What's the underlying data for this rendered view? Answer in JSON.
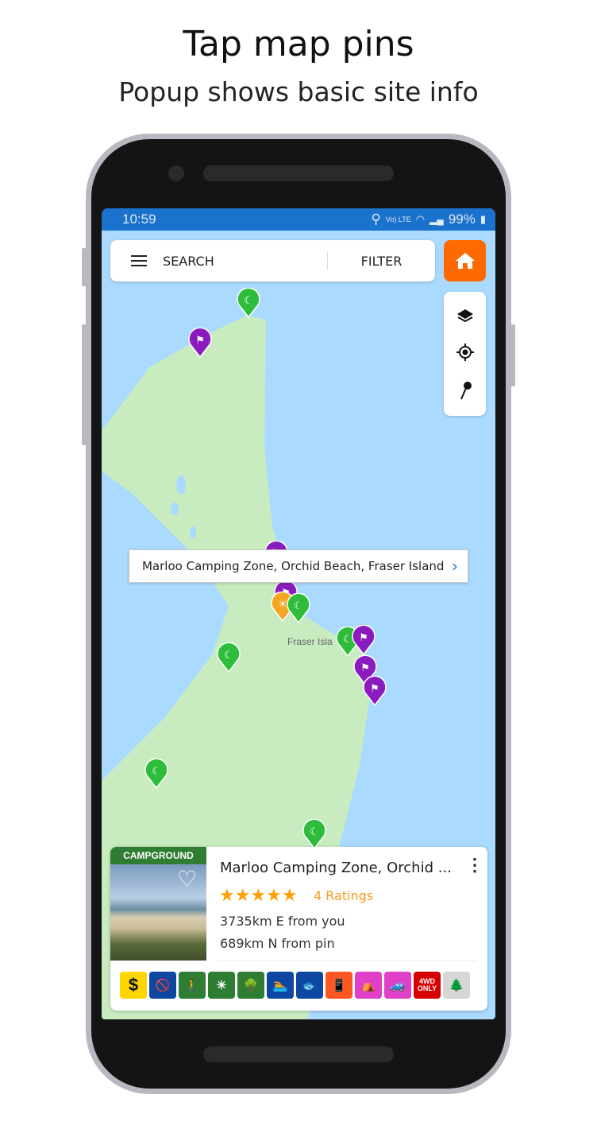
{
  "header": {
    "title": "Tap map pins",
    "subtitle": "Popup shows basic site info"
  },
  "status": {
    "time": "10:59",
    "network": "Vo) LTE",
    "battery": "99%"
  },
  "searchbar": {
    "search_label": "SEARCH",
    "filter_label": "FILTER"
  },
  "colors": {
    "accent": "#ff6a00",
    "status_bar": "#1a72cc",
    "water": "#aadaff",
    "land": "#c8ecc0",
    "pin_green": "#2ebd3a",
    "pin_purple": "#8a1bbf",
    "pin_orange": "#f5a623"
  },
  "map": {
    "place_label": "Fraser Isla",
    "tooltip": "Marloo Camping Zone, Orchid Beach, Fraser Island"
  },
  "card": {
    "category": "CAMPGROUND",
    "title": "Marloo Camping Zone, Orchid ...",
    "rating": 5,
    "stars": "★★★★★",
    "ratings_label": "4 Ratings",
    "distance_you": "3735km E from you",
    "distance_pin": "689km N from pin",
    "amenities": [
      {
        "name": "fee",
        "glyph": "$",
        "color": "#ffd600",
        "fg": "#111"
      },
      {
        "name": "no-dogs",
        "glyph": "🚫",
        "color": "#0d47a1"
      },
      {
        "name": "walking-trail",
        "glyph": "🚶",
        "color": "#2e7d32"
      },
      {
        "name": "scenic-view",
        "glyph": "☀",
        "color": "#2e7d32"
      },
      {
        "name": "shade",
        "glyph": "🌳",
        "color": "#2e7d32"
      },
      {
        "name": "swimming",
        "glyph": "🏊",
        "color": "#0d47a1"
      },
      {
        "name": "fishing",
        "glyph": "🐟",
        "color": "#0d47a1"
      },
      {
        "name": "phone-coverage",
        "glyph": "📱",
        "color": "#ff5722"
      },
      {
        "name": "tent-camping",
        "glyph": "⛺",
        "color": "#e040c8"
      },
      {
        "name": "trailer",
        "glyph": "🚙",
        "color": "#e040c8"
      },
      {
        "name": "4wd-only",
        "glyph": "4WD ONLY",
        "color": "#d50000"
      },
      {
        "name": "national-park",
        "glyph": "🌲",
        "color": "#d6d6d6",
        "fg": "#2e7d32"
      }
    ]
  }
}
